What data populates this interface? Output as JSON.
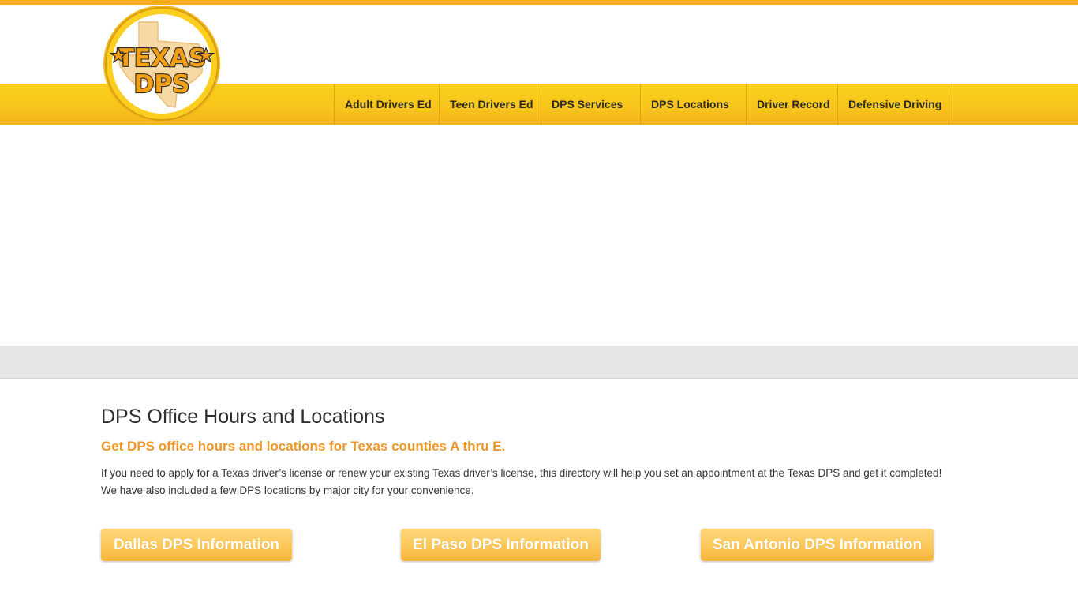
{
  "logo": {
    "line1": "TEXAS",
    "line2": "DPS",
    "icon": "texas-state-star-icon"
  },
  "nav": {
    "items": [
      {
        "label": "Adult Drivers Ed"
      },
      {
        "label": "Teen Drivers Ed"
      },
      {
        "label": "DPS Services"
      },
      {
        "label": "DPS Locations"
      },
      {
        "label": "Driver Record"
      },
      {
        "label": "Defensive Driving"
      }
    ]
  },
  "main": {
    "title": "DPS Office Hours and Locations",
    "subtitle": "Get DPS office hours and locations for Texas counties A thru E.",
    "paragraph_line1": "If you need to apply for a Texas driver’s license or renew your existing Texas driver’s license, this directory will help you set an appointment at the Texas DPS and get it completed!",
    "paragraph_line2": "We have also included a few DPS locations by major city for your convenience."
  },
  "buttons": {
    "dallas": "Dallas DPS Information",
    "el_paso": "El Paso DPS Information",
    "san_antonio": "San Antonio DPS Information"
  },
  "colors": {
    "accent_gold": "#f8c51b",
    "stripe_orange": "#f6ae1c",
    "subtitle_orange": "#ee9626",
    "button_orange": "#fcc95c"
  }
}
